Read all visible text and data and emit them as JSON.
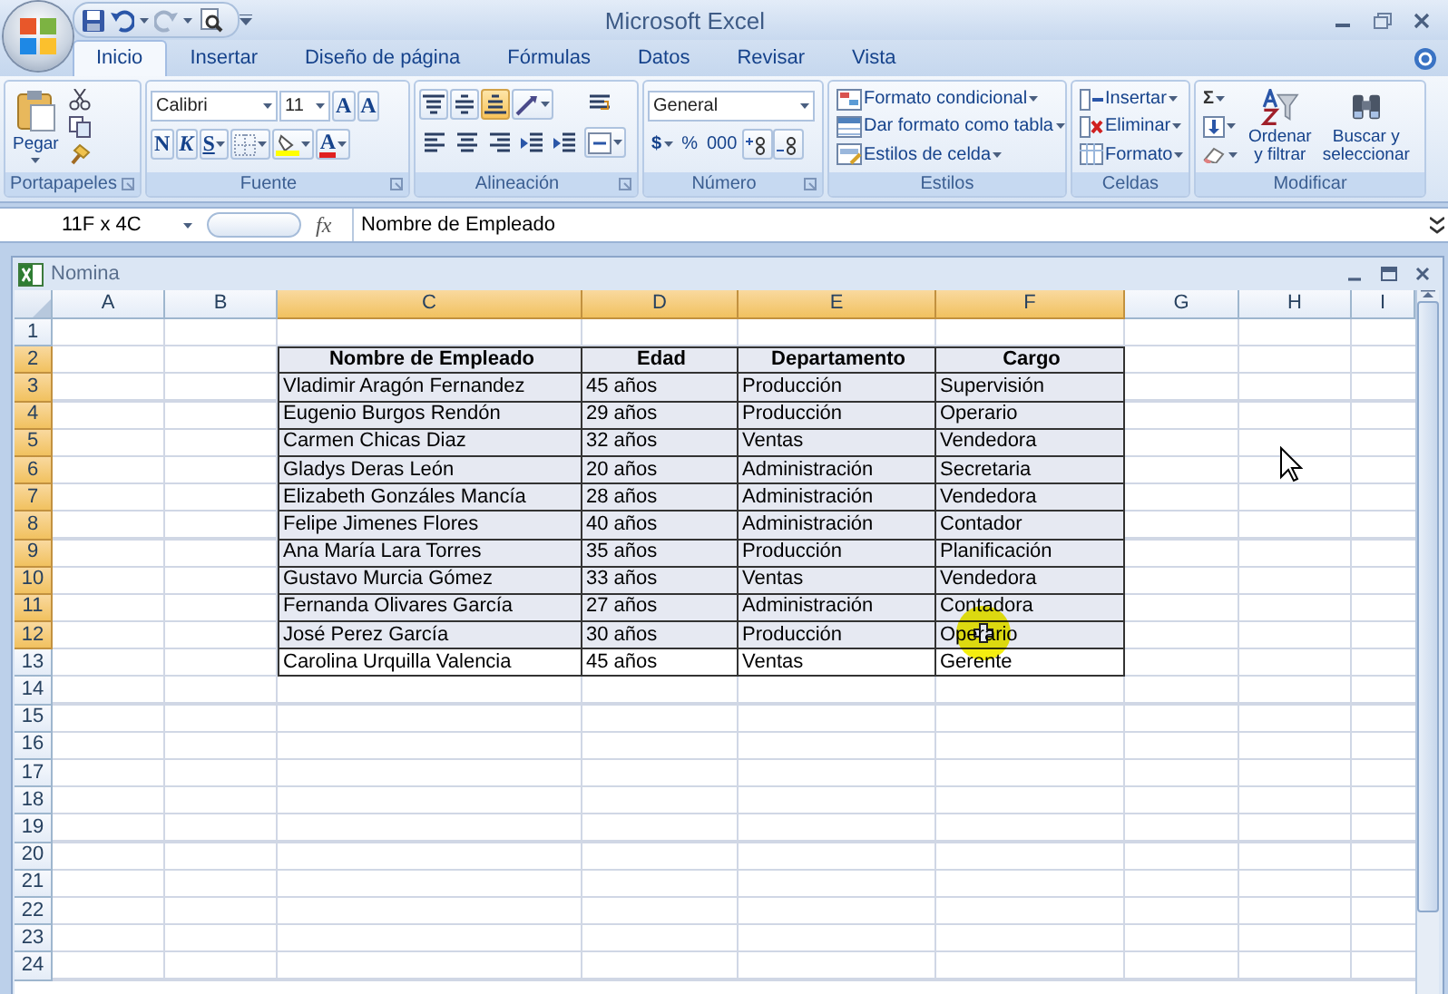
{
  "window": {
    "title": "Microsoft Excel"
  },
  "tabs": [
    {
      "label": "Inicio",
      "selected": true
    },
    {
      "label": "Insertar",
      "selected": false
    },
    {
      "label": "Diseño de página",
      "selected": false
    },
    {
      "label": "Fórmulas",
      "selected": false
    },
    {
      "label": "Datos",
      "selected": false
    },
    {
      "label": "Revisar",
      "selected": false
    },
    {
      "label": "Vista",
      "selected": false
    }
  ],
  "ribbon": {
    "clipboard": {
      "label": "Portapapeles",
      "paste": "Pegar"
    },
    "font": {
      "label": "Fuente",
      "name": "Calibri",
      "size": "11",
      "grow": "A",
      "shrink": "A",
      "bold": "N",
      "italic": "K",
      "underline": "S",
      "font_color": "A"
    },
    "alignment": {
      "label": "Alineación",
      "vertical_buttons": [
        {
          "selected": false
        },
        {
          "selected": false
        },
        {
          "selected": true
        }
      ]
    },
    "number": {
      "label": "Número",
      "format": "General",
      "currency": "$",
      "percent": "%",
      "thousands": "000"
    },
    "styles": {
      "label": "Estilos",
      "items": [
        "Formato condicional",
        "Dar formato como tabla",
        "Estilos de celda"
      ]
    },
    "cells": {
      "label": "Celdas",
      "items": [
        "Insertar",
        "Eliminar",
        "Formato"
      ]
    },
    "editing": {
      "label": "Modificar",
      "sum": "Σ",
      "sort": "Ordenar\ny filtrar",
      "find": "Buscar y\nseleccionar"
    }
  },
  "formula_bar": {
    "name_box": "11F x 4C",
    "fx": "fx",
    "value": "Nombre de Empleado"
  },
  "workbook": {
    "title": "Nomina",
    "columns": [
      {
        "label": "A",
        "selected": false
      },
      {
        "label": "B",
        "selected": false
      },
      {
        "label": "C",
        "selected": true
      },
      {
        "label": "D",
        "selected": true
      },
      {
        "label": "E",
        "selected": true
      },
      {
        "label": "F",
        "selected": true
      },
      {
        "label": "G",
        "selected": false
      },
      {
        "label": "H",
        "selected": false
      },
      {
        "label": "I",
        "selected": false
      }
    ],
    "rows": [
      {
        "label": "1",
        "selected": false
      },
      {
        "label": "2",
        "selected": true,
        "kind": "header",
        "cells": [
          "Nombre de Empleado",
          "Edad",
          "Departamento",
          "Cargo"
        ]
      },
      {
        "label": "3",
        "selected": true,
        "kind": "data",
        "cells": [
          "Vladimir Aragón Fernandez",
          "45 años",
          "Producción",
          "Supervisión"
        ]
      },
      {
        "label": "4",
        "selected": true,
        "kind": "data",
        "cells": [
          "Eugenio Burgos Rendón",
          "29 años",
          "Producción",
          "Operario"
        ]
      },
      {
        "label": "5",
        "selected": true,
        "kind": "data",
        "cells": [
          "Carmen Chicas Diaz",
          "32 años",
          "Ventas",
          "Vendedora"
        ]
      },
      {
        "label": "6",
        "selected": true,
        "kind": "data",
        "cells": [
          "Gladys Deras León",
          "20 años",
          "Administración",
          "Secretaria"
        ]
      },
      {
        "label": "7",
        "selected": true,
        "kind": "data",
        "cells": [
          "Elizabeth Gonzáles Mancía",
          "28 años",
          "Administración",
          "Vendedora"
        ]
      },
      {
        "label": "8",
        "selected": true,
        "kind": "data",
        "cells": [
          "Felipe Jimenes Flores",
          "40 años",
          "Administración",
          "Contador"
        ]
      },
      {
        "label": "9",
        "selected": true,
        "kind": "data",
        "cells": [
          "Ana María Lara Torres",
          "35 años",
          "Producción",
          "Planificación"
        ]
      },
      {
        "label": "10",
        "selected": true,
        "kind": "data",
        "cells": [
          "Gustavo Murcia Gómez",
          "33 años",
          "Ventas",
          "Vendedora"
        ]
      },
      {
        "label": "11",
        "selected": true,
        "kind": "data",
        "cells": [
          "Fernanda Olivares García",
          "27 años",
          "Administración",
          "Contadora"
        ]
      },
      {
        "label": "12",
        "selected": true,
        "kind": "data",
        "cells": [
          "José Perez García",
          "30 años",
          "Producción",
          "Operario"
        ]
      },
      {
        "label": "13",
        "selected": false,
        "kind": "data",
        "cells": [
          "Carolina Urquilla Valencia",
          "45 años",
          "Ventas",
          "Gerente"
        ]
      },
      {
        "label": "14",
        "selected": false
      },
      {
        "label": "15",
        "selected": false
      },
      {
        "label": "16",
        "selected": false
      },
      {
        "label": "17",
        "selected": false
      },
      {
        "label": "18",
        "selected": false
      },
      {
        "label": "19",
        "selected": false
      },
      {
        "label": "20",
        "selected": false
      },
      {
        "label": "21",
        "selected": false
      },
      {
        "label": "22",
        "selected": false
      },
      {
        "label": "23",
        "selected": false
      },
      {
        "label": "24",
        "selected": false
      }
    ]
  }
}
